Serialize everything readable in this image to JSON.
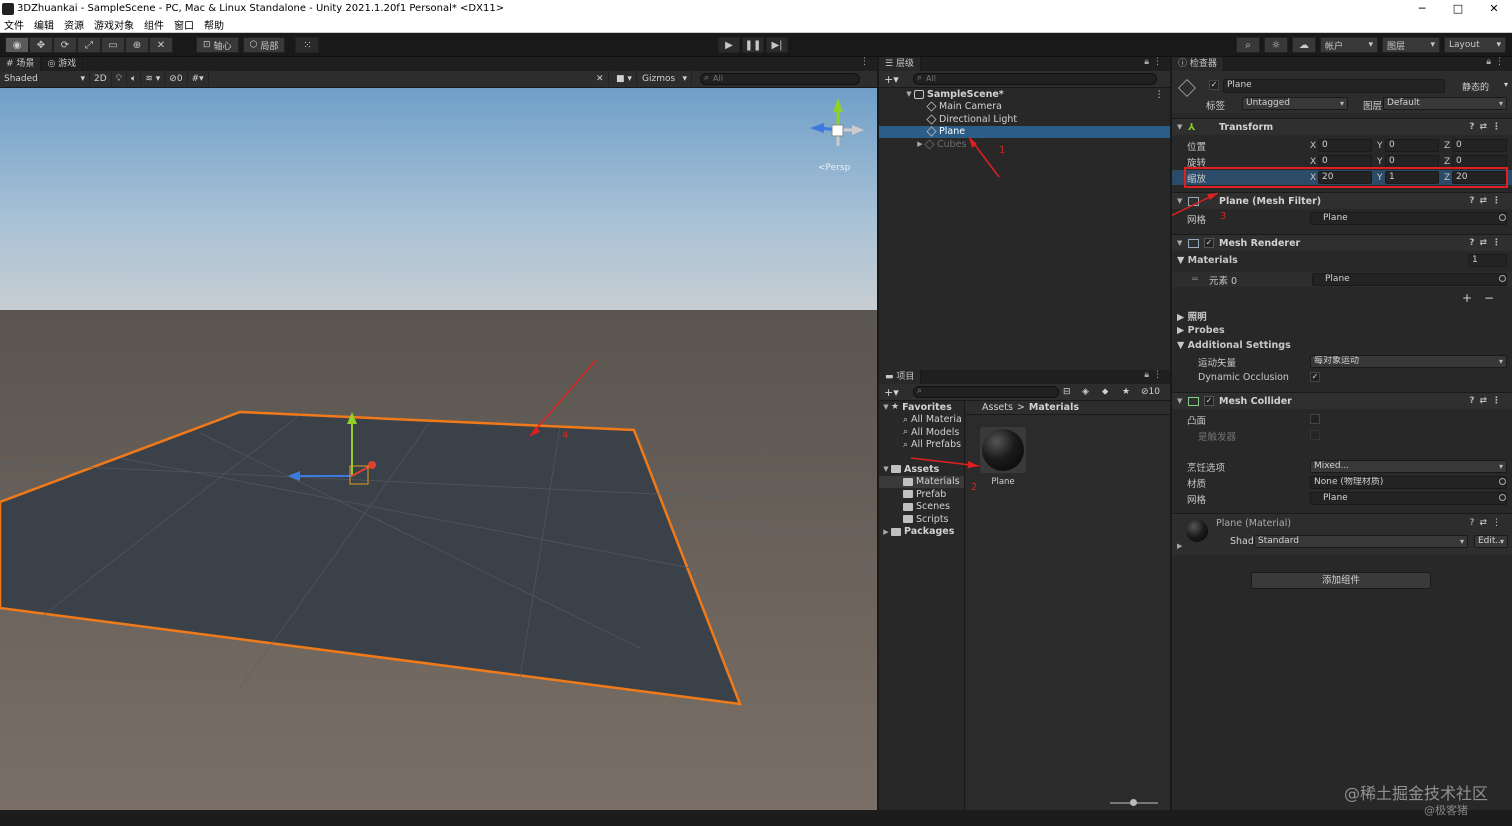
{
  "window": {
    "title": "3DZhuankai - SampleScene - PC, Mac & Linux Standalone - Unity 2021.1.20f1 Personal* <DX11>",
    "minimize": "─",
    "maximize": "□",
    "close": "✕"
  },
  "menu": [
    "文件",
    "编辑",
    "资源",
    "游戏对象",
    "组件",
    "窗口",
    "帮助"
  ],
  "toolbar": {
    "pivot_label": "轴心",
    "local_label": "局部",
    "account_label": "帐户",
    "layers_label": "图层",
    "layout_label": "Layout"
  },
  "scene": {
    "tab_scene": "场景",
    "tab_game": "游戏",
    "shading_mode": "Shaded",
    "mode_2d": "2D",
    "hidden_count": "0",
    "gizmos_label": "Gizmos",
    "search_placeholder": "All",
    "gizmo_axis_label": "<Persp",
    "annotation_number": "4"
  },
  "hierarchy": {
    "tab_label": "层级",
    "search_placeholder": "All",
    "scene_name": "SampleScene*",
    "items": [
      "Main Camera",
      "Directional Light",
      "Plane",
      "Cubes"
    ],
    "annotation_number": "1"
  },
  "project": {
    "tab_label": "项目",
    "hidden_count": "10",
    "tree": {
      "favorites": "Favorites",
      "fav_items": [
        "All Materia",
        "All Models",
        "All Prefabs"
      ],
      "assets": "Assets",
      "asset_folders": [
        "Materials",
        "Prefab",
        "Scenes",
        "Scripts"
      ],
      "packages": "Packages"
    },
    "breadcrumb": [
      "Assets",
      "Materials"
    ],
    "breadcrumb_sep": ">",
    "asset_name": "Plane",
    "annotation_number": "2"
  },
  "inspector": {
    "tab_label": "检查器",
    "object_name": "Plane",
    "static_label": "静态的",
    "tag_label": "标签",
    "tag_value": "Untagged",
    "layer_label": "图层",
    "layer_value": "Default",
    "transform": {
      "title": "Transform",
      "position_label": "位置",
      "rotation_label": "旋转",
      "scale_label": "缩放",
      "axis_x": "X",
      "axis_y": "Y",
      "axis_z": "Z",
      "position": [
        "0",
        "0",
        "0"
      ],
      "rotation": [
        "0",
        "0",
        "0"
      ],
      "scale": [
        "20",
        "1",
        "20"
      ]
    },
    "mesh_filter": {
      "title": "Plane (Mesh Filter)",
      "mesh_label": "网格",
      "mesh_value": "Plane"
    },
    "mesh_renderer": {
      "title": "Mesh Renderer",
      "materials_label": "Materials",
      "materials_count": "1",
      "element_label": "元素 0",
      "element_value": "Plane",
      "plus": "+",
      "minus": "−",
      "lighting_label": "照明",
      "probes_label": "Probes",
      "additional_label": "Additional Settings",
      "motion_label": "运动矢量",
      "motion_value": "每对象运动",
      "dynamic_occlusion_label": "Dynamic Occlusion"
    },
    "mesh_collider": {
      "title": "Mesh Collider",
      "convex_label": "凸面",
      "trigger_label": "是触发器",
      "cooking_label": "烹饪选项",
      "cooking_value": "Mixed...",
      "material_label": "材质",
      "material_value": "None (物理材质)",
      "mesh_label": "网格",
      "mesh_value": "Plane"
    },
    "material": {
      "title": "Plane (Material)",
      "shader_label": "Shader",
      "shader_value": "Standard",
      "edit_label": "Edit..."
    },
    "add_component": "添加组件",
    "annotation_number": "3"
  },
  "watermark": {
    "line1": "@稀土掘金技术社区",
    "line2": "@极客猪"
  },
  "colors": {
    "selection": "#2c5d87",
    "highlight_red": "#e02020",
    "outline_orange": "#f07a1a"
  }
}
